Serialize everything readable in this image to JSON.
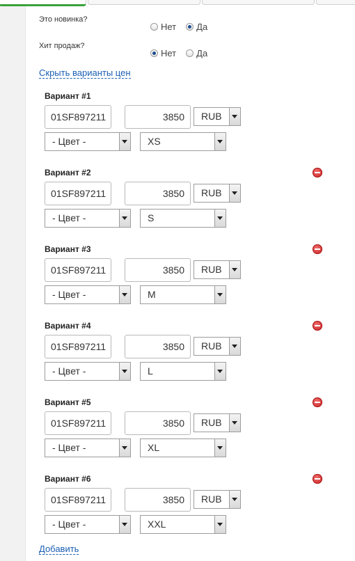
{
  "questions": {
    "new": {
      "label": "Это новинка?",
      "no": "Нет",
      "yes": "Да",
      "selected": "yes"
    },
    "hit": {
      "label": "Хит продаж?",
      "no": "Нет",
      "yes": "Да",
      "selected": "no"
    }
  },
  "toggle_link": "Скрыть варианты цен",
  "add_link": "Добавить",
  "variants": [
    {
      "title": "Вариант #1",
      "sku": "01SF897211",
      "price": "3850",
      "currency": "RUB",
      "color": "- Цвет -",
      "size": "XS",
      "removable": false
    },
    {
      "title": "Вариант #2",
      "sku": "01SF897211",
      "price": "3850",
      "currency": "RUB",
      "color": "- Цвет -",
      "size": "S",
      "removable": true
    },
    {
      "title": "Вариант #3",
      "sku": "01SF897211",
      "price": "3850",
      "currency": "RUB",
      "color": "- Цвет -",
      "size": "M",
      "removable": true
    },
    {
      "title": "Вариант #4",
      "sku": "01SF897211",
      "price": "3850",
      "currency": "RUB",
      "color": "- Цвет -",
      "size": "L",
      "removable": true
    },
    {
      "title": "Вариант #5",
      "sku": "01SF897211",
      "price": "3850",
      "currency": "RUB",
      "color": "- Цвет -",
      "size": "XL",
      "removable": true
    },
    {
      "title": "Вариант #6",
      "sku": "01SF897211",
      "price": "3850",
      "currency": "RUB",
      "color": "- Цвет -",
      "size": "XXL",
      "removable": true
    }
  ],
  "icons": {
    "remove": "remove-minus-icon",
    "dropdown": "chevron-down-icon"
  },
  "colors": {
    "link": "#1a5fb4",
    "remove": "#d32b2b",
    "active_tab": "#3aa23a"
  }
}
